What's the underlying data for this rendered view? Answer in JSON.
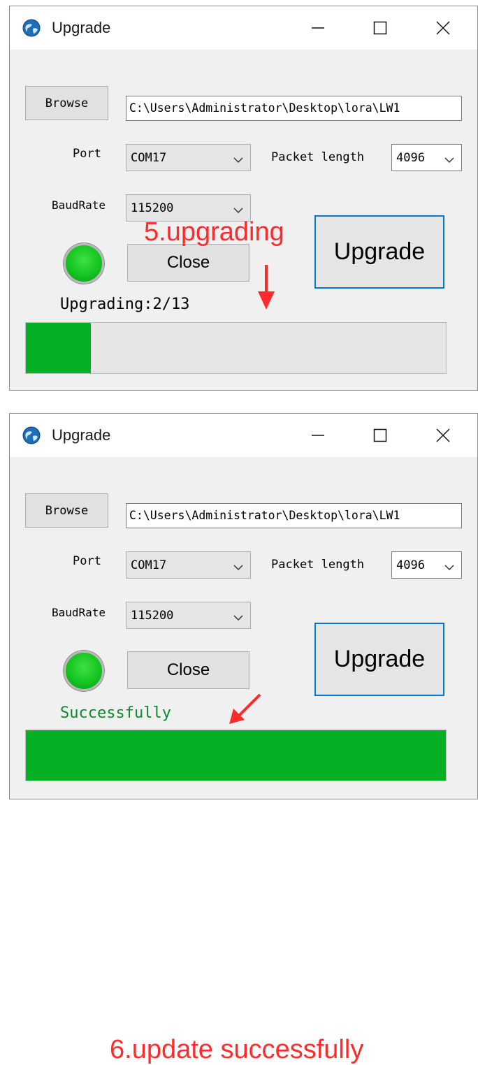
{
  "colors": {
    "progress_fill": "#06b025",
    "annotation": "#ff2b2b",
    "focus_border": "#0078d7",
    "led": "#14c520",
    "success_text": "#0a8a2a"
  },
  "icons": {
    "app": "app-globe-icon",
    "minimize": "minimize-icon",
    "maximize": "maximize-icon",
    "close": "close-icon",
    "dropdown": "chevron-down-icon",
    "arrow": "arrow-down-icon"
  },
  "windows": [
    {
      "title": "Upgrade",
      "browse_label": "Browse",
      "file_path": "C:\\Users\\Administrator\\Desktop\\lora\\LW1",
      "port_label": "Port",
      "port_value": "COM17",
      "packet_length_label": "Packet length",
      "packet_length_value": "4096",
      "baudrate_label": "BaudRate",
      "baudrate_value": "115200",
      "close_label": "Close",
      "upgrade_label": "Upgrade",
      "status": "Upgrading:2/13",
      "progress": {
        "current": 2,
        "total": 13
      },
      "annotation": "5.upgrading"
    },
    {
      "title": "Upgrade",
      "browse_label": "Browse",
      "file_path": "C:\\Users\\Administrator\\Desktop\\lora\\LW1",
      "port_label": "Port",
      "port_value": "COM17",
      "packet_length_label": "Packet length",
      "packet_length_value": "4096",
      "baudrate_label": "BaudRate",
      "baudrate_value": "115200",
      "close_label": "Close",
      "upgrade_label": "Upgrade",
      "status": "Successfully",
      "progress": {
        "current": 13,
        "total": 13
      },
      "annotation": "6.update successfully"
    }
  ]
}
